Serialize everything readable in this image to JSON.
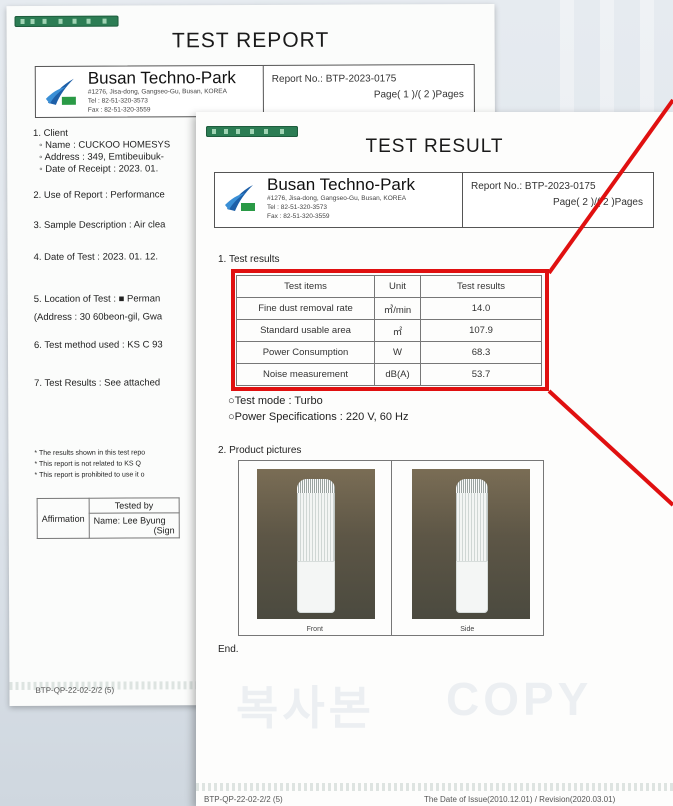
{
  "back_page": {
    "title": "TEST REPORT",
    "org_name": "Busan Techno-Park",
    "address": "#1276, Jisa-dong, Gangseo-Gu, Busan, KOREA",
    "tel": "Tel : 82-51-320-3573",
    "fax": "Fax : 82-51-320-3559",
    "report_no": "Report No.: BTP-2023-0175",
    "page": "Page( 1 )/( 2 )Pages",
    "lines": [
      "1. Client",
      "◦ Name : CUCKOO HOMESYS",
      "◦ Address : 349, Emtibeuibuk-",
      "◦ Date of Receipt : 2023. 01.",
      "2. Use of Report : Performance",
      "3. Sample Description : Air clea",
      "4. Date of Test : 2023. 01. 12.",
      "5. Location of Test : ■ Perman",
      "(Address : 30 60beon-gil, Gwa",
      "6. Test method used : KS C 93",
      "7. Test Results : See attached",
      "* The results shown in this test repo",
      "* This report is not related to KS Q",
      "* This report is prohibited to use it o"
    ],
    "affirmation": {
      "tested_by": "Tested by",
      "label": "Affirmation",
      "name": "Name: Lee Byung",
      "sign": "(Sign"
    },
    "footer": "BTP-QP-22-02-2/2 (5)"
  },
  "front_page": {
    "title": "TEST RESULT",
    "org_name": "Busan Techno-Park",
    "address": "#1276, Jisa-dong, Gangseo-Gu, Busan, KOREA",
    "tel": "Tel : 82-51-320-3573",
    "fax": "Fax : 82-51-320-3559",
    "report_no": "Report No.: BTP-2023-0175",
    "page": "Page( 2 )/( 2 )Pages",
    "section1": "1. Test results",
    "table": {
      "headers": [
        "Test items",
        "Unit",
        "Test results"
      ],
      "rows": [
        [
          "Fine dust removal rate",
          "㎥/min",
          "14.0"
        ],
        [
          "Standard usable area",
          "㎡",
          "107.9"
        ],
        [
          "Power Consumption",
          "W",
          "68.3"
        ],
        [
          "Noise measurement",
          "dB(A)",
          "53.7"
        ]
      ]
    },
    "test_mode": "○Test mode : Turbo",
    "power_spec": "○Power Specifications : 220 V, 60 Hz",
    "section2": "2. Product pictures",
    "photo_captions": [
      "Front",
      "Side"
    ],
    "end": "End.",
    "footer_left": "BTP-QP-22-02-2/2 (5)",
    "footer_right": "The Date of Issue(2010.12.01) / Revision(2020.03.01)"
  },
  "watermark": {
    "korean": "복사본",
    "english": "COPY"
  },
  "colors": {
    "highlight": "#e01010",
    "logo_blue": "#1d5fa8",
    "logo_green": "#2a9a46"
  }
}
